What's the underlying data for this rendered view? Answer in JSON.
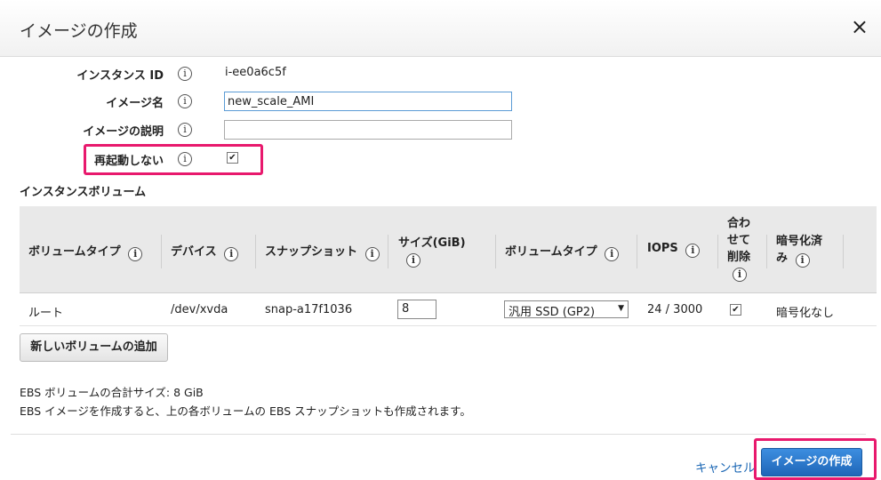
{
  "dialog": {
    "title": "イメージの作成",
    "close_label": "×"
  },
  "form": {
    "instance_id": {
      "label": "インスタンス ID",
      "value": "i-ee0a6c5f"
    },
    "image_name": {
      "label": "イメージ名",
      "value": "new_scale_AMI"
    },
    "image_description": {
      "label": "イメージの説明",
      "value": ""
    },
    "no_reboot": {
      "label": "再起動しない",
      "checked": true
    }
  },
  "volumes_section": {
    "title": "インスタンスボリューム",
    "columns": {
      "volume_type": "ボリュームタイプ",
      "device": "デバイス",
      "snapshot": "スナップショット",
      "size": "サイズ(GiB)",
      "volume_type2": "ボリュームタイプ",
      "iops": "IOPS",
      "delete_line1": "合わ",
      "delete_line2": "せて",
      "delete_line3": "削除",
      "encrypted_line1": "暗号化済",
      "encrypted_line2": "み"
    },
    "rows": [
      {
        "volume_type": "ルート",
        "device": "/dev/xvda",
        "snapshot": "snap-a17f1036",
        "size": "8",
        "type_select": "汎用 SSD (GP2)",
        "iops": "24 / 3000",
        "delete_on_termination": true,
        "encrypted": "暗号化なし"
      }
    ],
    "add_button": "新しいボリュームの追加"
  },
  "notes": {
    "total_size": "EBS ボリュームの合計サイズ: 8 GiB",
    "snapshot_note": "EBS イメージを作成すると、上の各ボリュームの EBS スナップショットも作成されます。"
  },
  "footer": {
    "cancel": "キャンセル",
    "create": "イメージの作成"
  },
  "icons": {
    "info": "i"
  },
  "colors": {
    "highlight": "#e8196d",
    "primary_button": "#1e66b8",
    "link": "#1a66b4"
  }
}
